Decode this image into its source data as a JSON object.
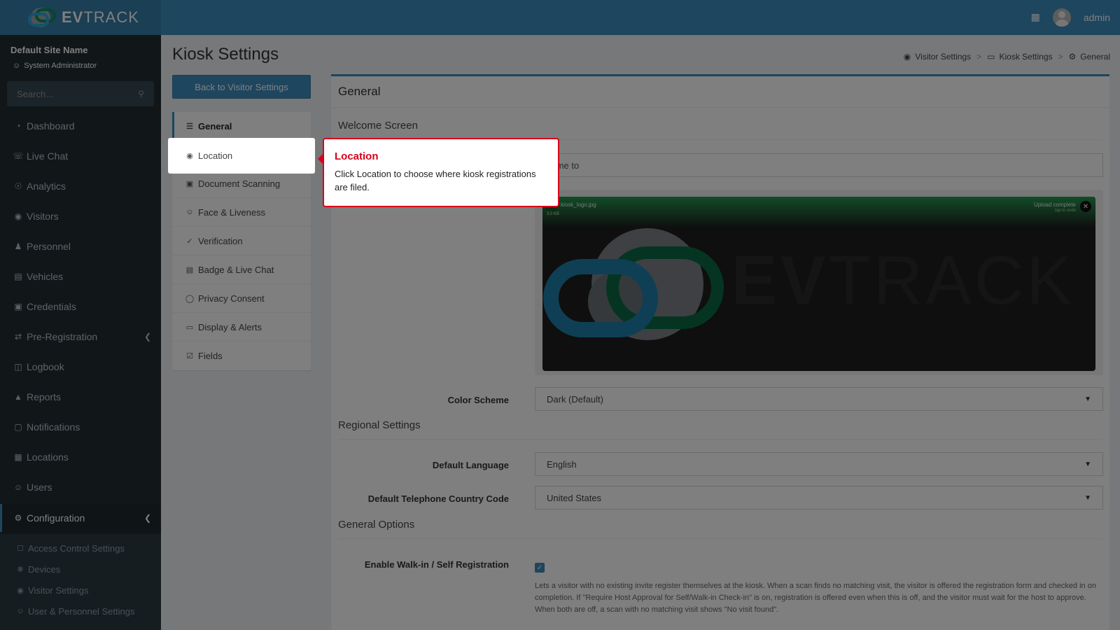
{
  "app": {
    "brand_bold": "EV",
    "brand_light": "TRACK",
    "user_name": "admin",
    "accent_color": "#3c8dbc",
    "tooltip_color": "#d9001b"
  },
  "sidebar": {
    "site_name": "Default Site Name",
    "role": "System Administrator",
    "search_placeholder": "Search...",
    "items": [
      {
        "label": "Dashboard",
        "icon": "dashboard-icon"
      },
      {
        "label": "Live Chat",
        "icon": "headset-icon"
      },
      {
        "label": "Analytics",
        "icon": "analytics-icon"
      },
      {
        "label": "Visitors",
        "icon": "eye-icon"
      },
      {
        "label": "Personnel",
        "icon": "personnel-icon"
      },
      {
        "label": "Vehicles",
        "icon": "car-icon"
      },
      {
        "label": "Credentials",
        "icon": "credentials-icon"
      },
      {
        "label": "Pre-Registration",
        "icon": "exchange-icon"
      },
      {
        "label": "Logbook",
        "icon": "book-icon"
      },
      {
        "label": "Reports",
        "icon": "reports-icon"
      },
      {
        "label": "Notifications",
        "icon": "notifications-icon"
      },
      {
        "label": "Locations",
        "icon": "building-icon"
      },
      {
        "label": "Users",
        "icon": "users-icon"
      },
      {
        "label": "Configuration",
        "icon": "gear-icon"
      }
    ],
    "sub_items": [
      {
        "label": "Access Control Settings",
        "icon": "lock-icon"
      },
      {
        "label": "Devices",
        "icon": "devices-icon"
      },
      {
        "label": "Visitor Settings",
        "icon": "eye-icon"
      },
      {
        "label": "User & Personnel Settings",
        "icon": "users-icon"
      }
    ]
  },
  "header": {
    "page_title": "Kiosk Settings",
    "breadcrumb": [
      "Visitor Settings",
      "Kiosk Settings",
      "General"
    ],
    "back_button": "Back to Visitor Settings"
  },
  "settings_nav": [
    {
      "label": "General",
      "icon": "sliders-icon"
    },
    {
      "label": "Location",
      "icon": "map-pin-icon"
    },
    {
      "label": "Document Scanning",
      "icon": "scan-icon"
    },
    {
      "label": "Face & Liveness",
      "icon": "face-icon"
    },
    {
      "label": "Verification",
      "icon": "shield-check-icon"
    },
    {
      "label": "Badge & Live Chat",
      "icon": "badge-icon"
    },
    {
      "label": "Privacy Consent",
      "icon": "shield-icon"
    },
    {
      "label": "Display & Alerts",
      "icon": "display-icon"
    },
    {
      "label": "Fields",
      "icon": "checklist-icon"
    }
  ],
  "main": {
    "card_title": "General",
    "welcome_section": "Welcome Screen",
    "welcome_value": "come to",
    "upload": {
      "file_name": "kiosk_logo.jpg",
      "file_size": "3.0 KB",
      "status": "Upload complete",
      "status_sub": "tap to undo"
    },
    "color_scheme_label": "Color Scheme",
    "color_scheme_value": "Dark (Default)",
    "regional_section": "Regional Settings",
    "default_language_label": "Default Language",
    "default_language_value": "English",
    "country_code_label": "Default Telephone Country Code",
    "country_code_value": "United States",
    "general_options_section": "General Options",
    "walkin_label": "Enable Walk-in / Self Registration",
    "walkin_checked": true,
    "walkin_help": "Lets a visitor with no existing invite register themselves at the kiosk. When a scan finds no matching visit, the visitor is offered the registration form and checked in on completion. If \"Require Host Approval for Self/Walk-in Check-in\" is on, registration is offered even when this is off, and the visitor must wait for the host to approve. When both are off, a scan with no matching visit shows \"No visit found\"."
  },
  "tooltip": {
    "title": "Location",
    "body": "Click Location to choose where kiosk registrations are filed."
  }
}
